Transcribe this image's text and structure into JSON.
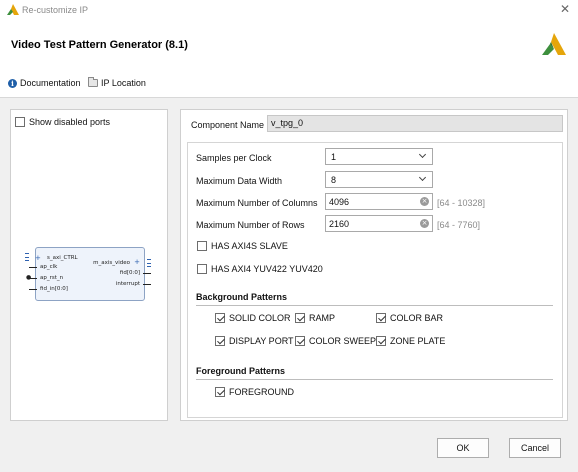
{
  "window": {
    "title": "Re-customize IP",
    "close_glyph": "✕"
  },
  "header": {
    "heading": "Video Test Pattern Generator (8.1)"
  },
  "links": {
    "documentation": "Documentation",
    "ip_location": "IP Location"
  },
  "left_panel": {
    "show_disabled_ports": {
      "label": "Show disabled ports",
      "checked": false
    },
    "block": {
      "left_pins": [
        "s_axi_CTRL",
        "ap_clk",
        "ap_rst_n",
        "fid_in[0:0]"
      ],
      "right_pins": [
        "m_axis_video",
        "fid[0:0]",
        "interrupt"
      ]
    }
  },
  "component": {
    "label": "Component Name",
    "value": "v_tpg_0"
  },
  "params": {
    "samples_per_clock": {
      "label": "Samples per Clock",
      "value": "1"
    },
    "max_data_width": {
      "label": "Maximum Data Width",
      "value": "8"
    },
    "max_columns": {
      "label": "Maximum Number of Columns",
      "value": "4096",
      "range": "[64 - 10328]"
    },
    "max_rows": {
      "label": "Maximum Number of Rows",
      "value": "2160",
      "range": "[64 - 7760]"
    },
    "has_axi4s_slave": {
      "label": "HAS AXI4S SLAVE",
      "checked": false
    },
    "has_axi4_yuv": {
      "label": "HAS AXI4 YUV422 YUV420",
      "checked": false
    }
  },
  "background": {
    "title": "Background Patterns",
    "patterns": [
      {
        "label": "SOLID COLOR",
        "checked": true
      },
      {
        "label": "RAMP",
        "checked": true
      },
      {
        "label": "COLOR BAR",
        "checked": true
      },
      {
        "label": "DISPLAY PORT",
        "checked": true
      },
      {
        "label": "COLOR SWEEP",
        "checked": true
      },
      {
        "label": "ZONE PLATE",
        "checked": true
      }
    ]
  },
  "foreground": {
    "title": "Foreground Patterns",
    "patterns": [
      {
        "label": "FOREGROUND",
        "checked": true
      }
    ]
  },
  "buttons": {
    "ok": "OK",
    "cancel": "Cancel"
  },
  "colors": {
    "accent_icon": "#e5a50a",
    "info_blue": "#1f5fa8",
    "range_gray": "#8a8a8a"
  },
  "icons": {
    "app": "xilinx-logo-icon",
    "close": "close-icon",
    "info": "info-icon",
    "folder": "folder-icon",
    "chevron": "chevron-down-icon",
    "clear": "clear-input-icon"
  }
}
